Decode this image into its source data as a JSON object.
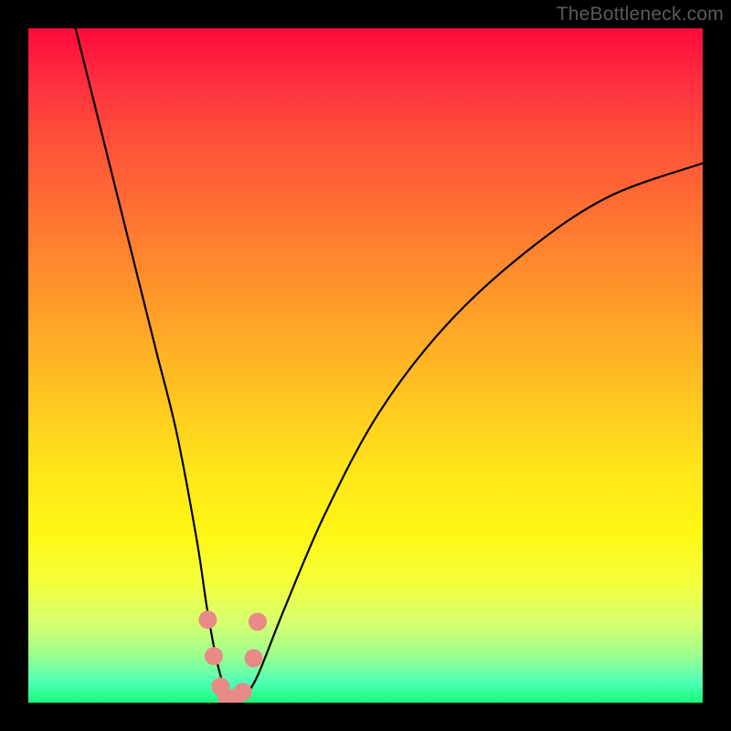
{
  "watermark": "TheBottleneck.com",
  "chart_data": {
    "type": "line",
    "title": "",
    "xlabel": "",
    "ylabel": "",
    "xlim": [
      0,
      100
    ],
    "ylim": [
      0,
      100
    ],
    "series": [
      {
        "name": "bottleneck-curve",
        "x": [
          7,
          10,
          13,
          16,
          19,
          22,
          25,
          26.5,
          28,
          29.5,
          30.5,
          32,
          34,
          38,
          44,
          52,
          62,
          74,
          86,
          100
        ],
        "y": [
          100,
          88,
          76,
          64,
          52,
          40,
          24,
          14,
          6,
          1,
          0,
          1,
          4,
          14,
          28,
          43,
          56,
          67,
          75,
          80
        ]
      }
    ],
    "markers": {
      "name": "highlight-points",
      "color": "#e88a86",
      "points": [
        {
          "x": 26.6,
          "y": 12.3
        },
        {
          "x": 27.5,
          "y": 6.9
        },
        {
          "x": 28.5,
          "y": 2.4
        },
        {
          "x": 29.4,
          "y": 0.7
        },
        {
          "x": 30.6,
          "y": 0.7
        },
        {
          "x": 31.8,
          "y": 1.6
        },
        {
          "x": 33.4,
          "y": 6.6
        },
        {
          "x": 34.0,
          "y": 12.0
        }
      ]
    },
    "background_gradient": {
      "type": "vertical",
      "stops": [
        {
          "offset": 0.0,
          "color": "#ff0a3c"
        },
        {
          "offset": 0.5,
          "color": "#ffb524"
        },
        {
          "offset": 0.8,
          "color": "#fbff1e"
        },
        {
          "offset": 1.0,
          "color": "#14ff79"
        }
      ]
    }
  }
}
